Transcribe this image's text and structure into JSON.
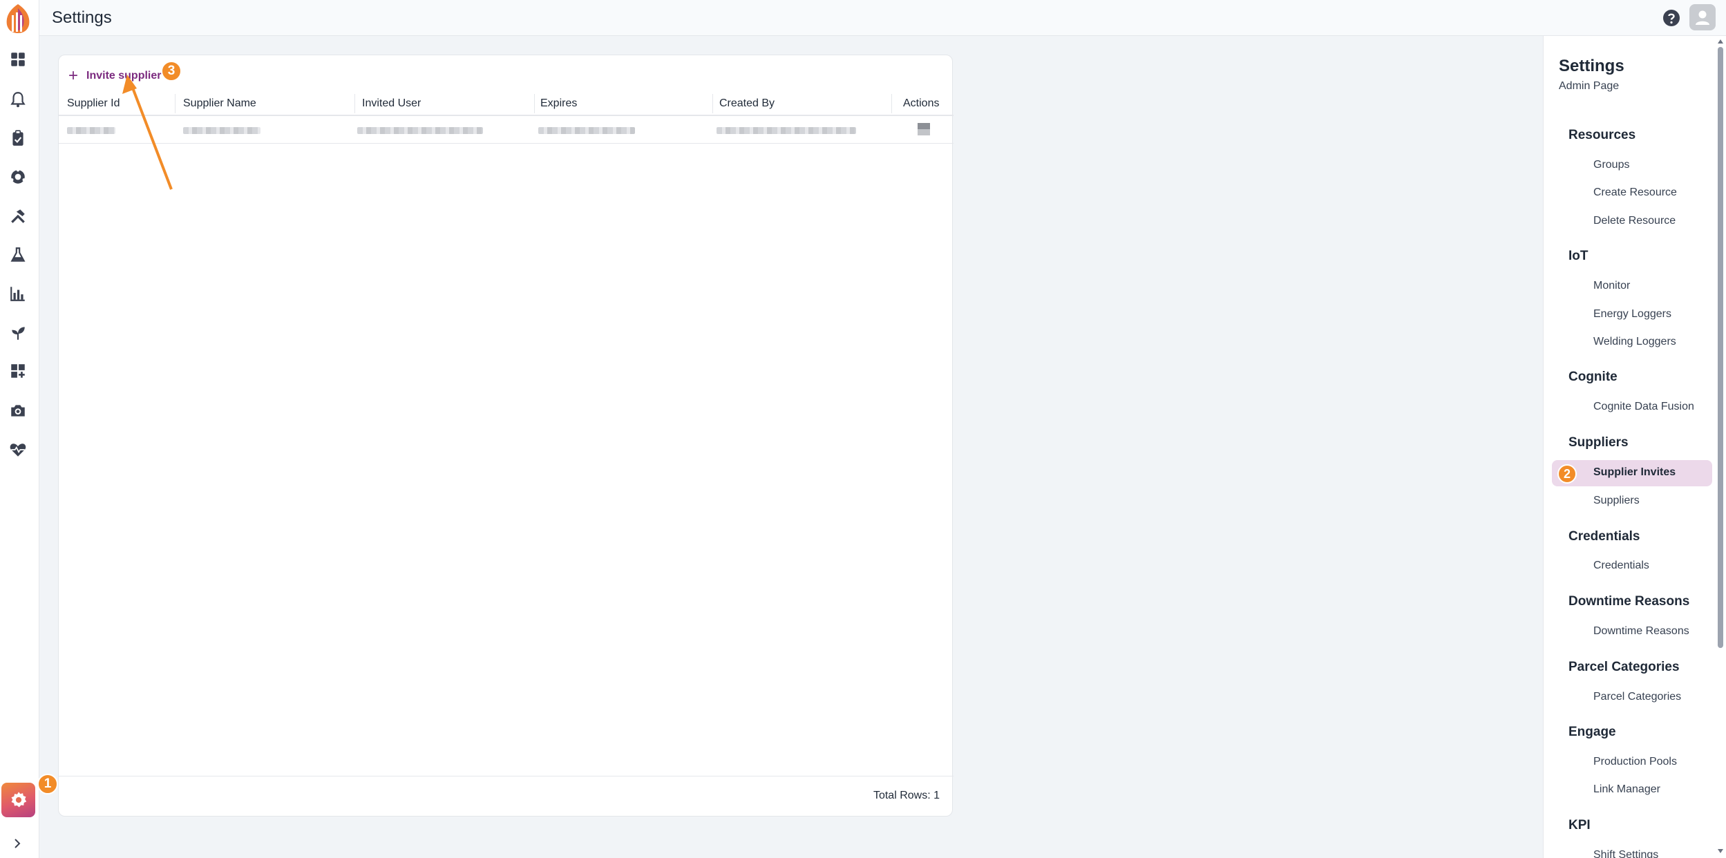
{
  "app": {
    "title": "Settings"
  },
  "rail": {
    "icons": [
      "dashboard-icon",
      "bell-icon",
      "clipboard-icon",
      "globe-icon",
      "hammer-icon",
      "flask-icon",
      "bar-chart-icon",
      "sprout-icon",
      "add-widget-icon",
      "camera-icon",
      "heartbeat-icon"
    ],
    "settings_icon": "gear-icon",
    "expand_icon": "chevron-right-icon"
  },
  "markers": {
    "one": "1",
    "two": "2",
    "three": "3"
  },
  "table": {
    "invite_label": "Invite supplier",
    "columns": [
      "Supplier Id",
      "Supplier Name",
      "Invited User",
      "Expires",
      "Created By",
      "Actions"
    ],
    "footer": "Total Rows: 1"
  },
  "settings_nav": {
    "title": "Settings",
    "subtitle": "Admin Page",
    "sections": [
      {
        "title": "Resources",
        "items": [
          "Groups",
          "Create Resource",
          "Delete Resource"
        ]
      },
      {
        "title": "IoT",
        "items": [
          "Monitor",
          "Energy Loggers",
          "Welding Loggers"
        ]
      },
      {
        "title": "Cognite",
        "items": [
          "Cognite Data Fusion"
        ]
      },
      {
        "title": "Suppliers",
        "items": [
          "Supplier Invites",
          "Suppliers"
        ]
      },
      {
        "title": "Credentials",
        "items": [
          "Credentials"
        ]
      },
      {
        "title": "Downtime Reasons",
        "items": [
          "Downtime Reasons"
        ]
      },
      {
        "title": "Parcel Categories",
        "items": [
          "Parcel Categories"
        ]
      },
      {
        "title": "Engage",
        "items": [
          "Production Pools",
          "Link Manager"
        ]
      },
      {
        "title": "KPI",
        "items": [
          "Shift Settings"
        ]
      }
    ],
    "active_item": "Supplier Invites"
  },
  "colors": {
    "accent": "#7b2a7f",
    "marker": "#f28c28",
    "active_bg": "#ecd9ea"
  }
}
